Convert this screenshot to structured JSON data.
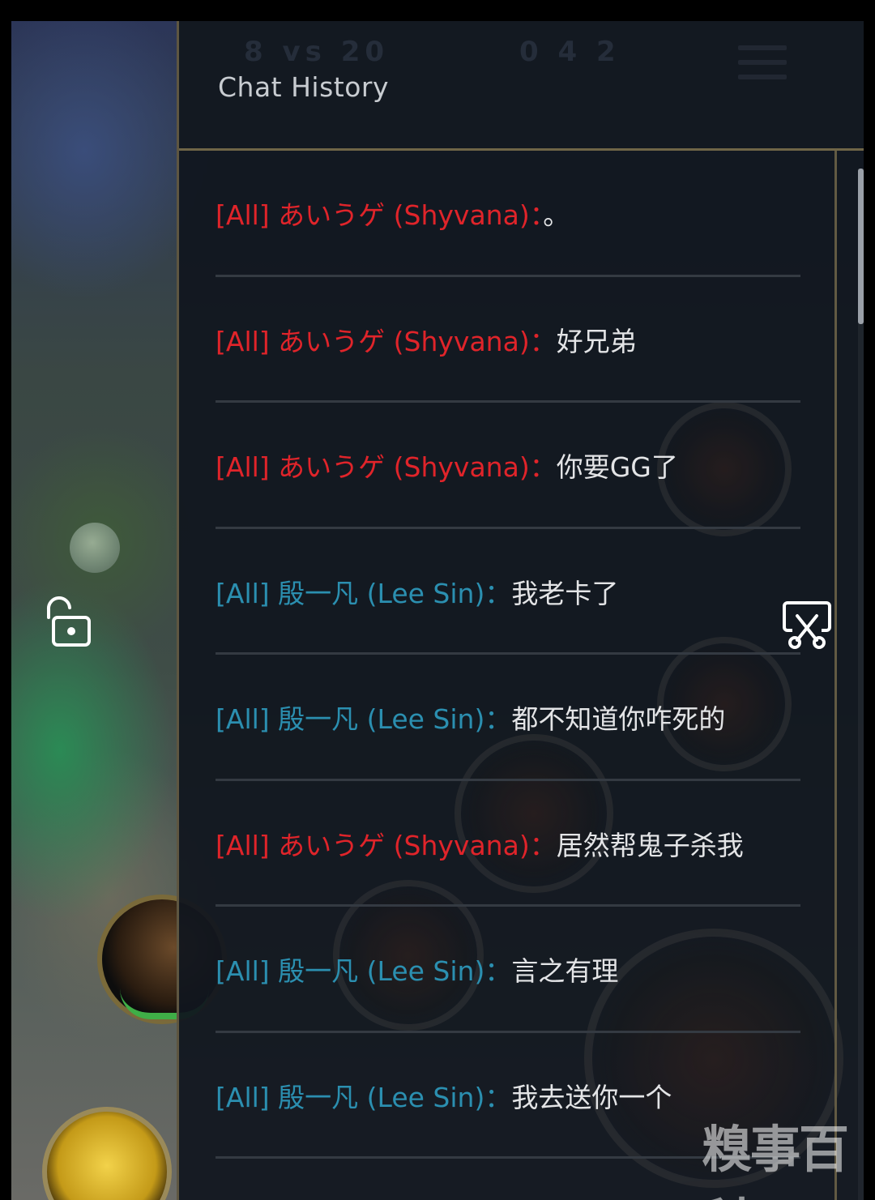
{
  "panel": {
    "title": "Chat History"
  },
  "messages": [
    {
      "channel": "[All]",
      "sender": "あいうゲ (Shyvana)",
      "sep": "：",
      "text": "。",
      "team": "enemy"
    },
    {
      "channel": "[All]",
      "sender": "あいうゲ (Shyvana)",
      "sep": "：",
      "text": "好兄弟",
      "team": "enemy"
    },
    {
      "channel": "[All]",
      "sender": "あいうゲ (Shyvana)",
      "sep": "：",
      "text": "你要GG了",
      "team": "enemy"
    },
    {
      "channel": "[All]",
      "sender": "殷一凡 (Lee Sin)",
      "sep": "：",
      "text": "我老卡了",
      "team": "ally"
    },
    {
      "channel": "[All]",
      "sender": "殷一凡 (Lee Sin)",
      "sep": "：",
      "text": "都不知道你咋死的",
      "team": "ally"
    },
    {
      "channel": "[All]",
      "sender": "あいうゲ (Shyvana)",
      "sep": "：",
      "text": "居然帮鬼子杀我",
      "team": "enemy"
    },
    {
      "channel": "[All]",
      "sender": "殷一凡 (Lee Sin)",
      "sep": "：",
      "text": "言之有理",
      "team": "ally"
    },
    {
      "channel": "[All]",
      "sender": "殷一凡 (Lee Sin)",
      "sep": "：",
      "text": "我去送你一个",
      "team": "ally"
    }
  ],
  "watermark": "糗事百科",
  "colors": {
    "enemy": "#e0242a",
    "ally": "#2b8fb0",
    "message": "#e3e4e6",
    "panel_border": "#6f6547"
  },
  "icons": {
    "lock": "unlock-icon",
    "screenshot": "screenshot-scissors-icon"
  }
}
